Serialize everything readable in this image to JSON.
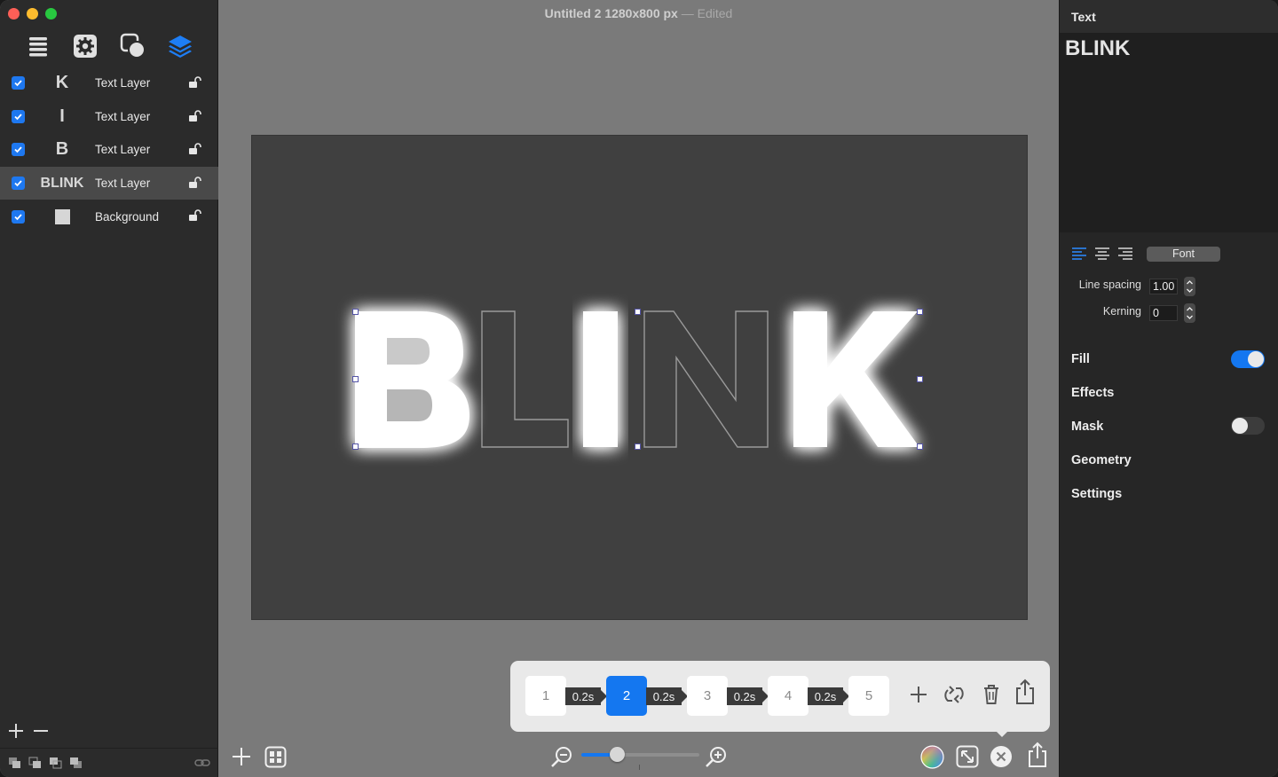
{
  "window": {
    "title": "Untitled 2 1280x800 px",
    "separator": "—",
    "status": "Edited"
  },
  "sidebar": {
    "tools": [
      {
        "name": "list-icon"
      },
      {
        "name": "gear-icon"
      },
      {
        "name": "shapes-icon"
      },
      {
        "name": "layers-icon",
        "active": true
      }
    ],
    "layers": [
      {
        "thumb": "K",
        "label": "Text Layer",
        "checked": true,
        "selected": false
      },
      {
        "thumb": "I",
        "label": "Text Layer",
        "checked": true,
        "selected": false
      },
      {
        "thumb": "B",
        "label": "Text Layer",
        "checked": true,
        "selected": false
      },
      {
        "thumb": "BLINK",
        "label": "Text Layer",
        "checked": true,
        "selected": true
      },
      {
        "thumb": "",
        "label": "Background",
        "checked": true,
        "selected": false
      }
    ]
  },
  "canvas": {
    "text": "BLINK"
  },
  "frames": {
    "items": [
      {
        "label": "1",
        "active": false
      },
      {
        "label": "2",
        "active": true
      },
      {
        "label": "3",
        "active": false
      },
      {
        "label": "4",
        "active": false
      },
      {
        "label": "5",
        "active": false
      }
    ],
    "delays": [
      "0.2s",
      "0.2s",
      "0.2s",
      "0.2s"
    ]
  },
  "zoom": {
    "level": 0.3
  },
  "inspector": {
    "header": "Text",
    "text_content": "BLINK",
    "font_button": "Font",
    "line_spacing_label": "Line spacing",
    "line_spacing_value": "1.00",
    "kerning_label": "Kerning",
    "kerning_value": "0",
    "sections": {
      "fill": "Fill",
      "effects": "Effects",
      "mask": "Mask",
      "geometry": "Geometry",
      "settings": "Settings"
    },
    "fill_enabled": true,
    "mask_enabled": false
  },
  "colors": {
    "accent": "#1477f0",
    "sidebar_bg": "#2b2b2b",
    "canvas_bg": "#404040",
    "workspace_bg": "#7a7a7a"
  }
}
